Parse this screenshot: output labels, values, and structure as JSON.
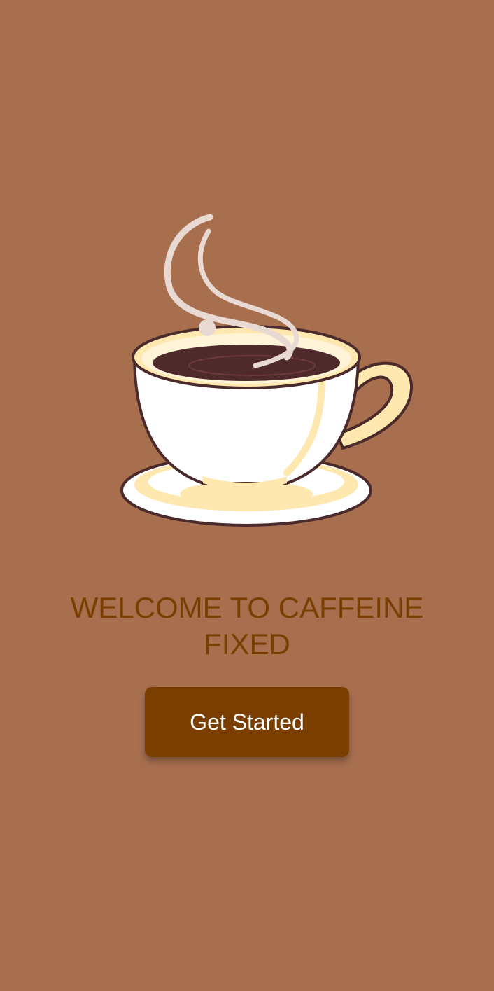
{
  "welcome": {
    "title": "WELCOME TO CAFFEINE FIXED",
    "illustration_icon": "coffee-cup-icon"
  },
  "actions": {
    "get_started_label": "Get Started"
  },
  "colors": {
    "background": "#A86F4F",
    "accent": "#7A3F00",
    "button_text": "#FFFFFF"
  }
}
